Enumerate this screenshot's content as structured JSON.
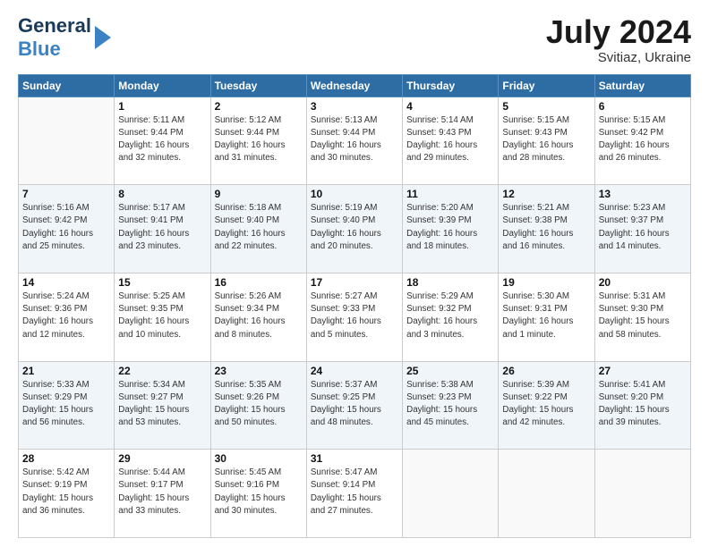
{
  "header": {
    "logo_line1": "General",
    "logo_line2": "Blue",
    "month_year": "July 2024",
    "location": "Svitiaz, Ukraine"
  },
  "days_of_week": [
    "Sunday",
    "Monday",
    "Tuesday",
    "Wednesday",
    "Thursday",
    "Friday",
    "Saturday"
  ],
  "weeks": [
    [
      {
        "day": "",
        "info": ""
      },
      {
        "day": "1",
        "info": "Sunrise: 5:11 AM\nSunset: 9:44 PM\nDaylight: 16 hours\nand 32 minutes."
      },
      {
        "day": "2",
        "info": "Sunrise: 5:12 AM\nSunset: 9:44 PM\nDaylight: 16 hours\nand 31 minutes."
      },
      {
        "day": "3",
        "info": "Sunrise: 5:13 AM\nSunset: 9:44 PM\nDaylight: 16 hours\nand 30 minutes."
      },
      {
        "day": "4",
        "info": "Sunrise: 5:14 AM\nSunset: 9:43 PM\nDaylight: 16 hours\nand 29 minutes."
      },
      {
        "day": "5",
        "info": "Sunrise: 5:15 AM\nSunset: 9:43 PM\nDaylight: 16 hours\nand 28 minutes."
      },
      {
        "day": "6",
        "info": "Sunrise: 5:15 AM\nSunset: 9:42 PM\nDaylight: 16 hours\nand 26 minutes."
      }
    ],
    [
      {
        "day": "7",
        "info": "Sunrise: 5:16 AM\nSunset: 9:42 PM\nDaylight: 16 hours\nand 25 minutes."
      },
      {
        "day": "8",
        "info": "Sunrise: 5:17 AM\nSunset: 9:41 PM\nDaylight: 16 hours\nand 23 minutes."
      },
      {
        "day": "9",
        "info": "Sunrise: 5:18 AM\nSunset: 9:40 PM\nDaylight: 16 hours\nand 22 minutes."
      },
      {
        "day": "10",
        "info": "Sunrise: 5:19 AM\nSunset: 9:40 PM\nDaylight: 16 hours\nand 20 minutes."
      },
      {
        "day": "11",
        "info": "Sunrise: 5:20 AM\nSunset: 9:39 PM\nDaylight: 16 hours\nand 18 minutes."
      },
      {
        "day": "12",
        "info": "Sunrise: 5:21 AM\nSunset: 9:38 PM\nDaylight: 16 hours\nand 16 minutes."
      },
      {
        "day": "13",
        "info": "Sunrise: 5:23 AM\nSunset: 9:37 PM\nDaylight: 16 hours\nand 14 minutes."
      }
    ],
    [
      {
        "day": "14",
        "info": "Sunrise: 5:24 AM\nSunset: 9:36 PM\nDaylight: 16 hours\nand 12 minutes."
      },
      {
        "day": "15",
        "info": "Sunrise: 5:25 AM\nSunset: 9:35 PM\nDaylight: 16 hours\nand 10 minutes."
      },
      {
        "day": "16",
        "info": "Sunrise: 5:26 AM\nSunset: 9:34 PM\nDaylight: 16 hours\nand 8 minutes."
      },
      {
        "day": "17",
        "info": "Sunrise: 5:27 AM\nSunset: 9:33 PM\nDaylight: 16 hours\nand 5 minutes."
      },
      {
        "day": "18",
        "info": "Sunrise: 5:29 AM\nSunset: 9:32 PM\nDaylight: 16 hours\nand 3 minutes."
      },
      {
        "day": "19",
        "info": "Sunrise: 5:30 AM\nSunset: 9:31 PM\nDaylight: 16 hours\nand 1 minute."
      },
      {
        "day": "20",
        "info": "Sunrise: 5:31 AM\nSunset: 9:30 PM\nDaylight: 15 hours\nand 58 minutes."
      }
    ],
    [
      {
        "day": "21",
        "info": "Sunrise: 5:33 AM\nSunset: 9:29 PM\nDaylight: 15 hours\nand 56 minutes."
      },
      {
        "day": "22",
        "info": "Sunrise: 5:34 AM\nSunset: 9:27 PM\nDaylight: 15 hours\nand 53 minutes."
      },
      {
        "day": "23",
        "info": "Sunrise: 5:35 AM\nSunset: 9:26 PM\nDaylight: 15 hours\nand 50 minutes."
      },
      {
        "day": "24",
        "info": "Sunrise: 5:37 AM\nSunset: 9:25 PM\nDaylight: 15 hours\nand 48 minutes."
      },
      {
        "day": "25",
        "info": "Sunrise: 5:38 AM\nSunset: 9:23 PM\nDaylight: 15 hours\nand 45 minutes."
      },
      {
        "day": "26",
        "info": "Sunrise: 5:39 AM\nSunset: 9:22 PM\nDaylight: 15 hours\nand 42 minutes."
      },
      {
        "day": "27",
        "info": "Sunrise: 5:41 AM\nSunset: 9:20 PM\nDaylight: 15 hours\nand 39 minutes."
      }
    ],
    [
      {
        "day": "28",
        "info": "Sunrise: 5:42 AM\nSunset: 9:19 PM\nDaylight: 15 hours\nand 36 minutes."
      },
      {
        "day": "29",
        "info": "Sunrise: 5:44 AM\nSunset: 9:17 PM\nDaylight: 15 hours\nand 33 minutes."
      },
      {
        "day": "30",
        "info": "Sunrise: 5:45 AM\nSunset: 9:16 PM\nDaylight: 15 hours\nand 30 minutes."
      },
      {
        "day": "31",
        "info": "Sunrise: 5:47 AM\nSunset: 9:14 PM\nDaylight: 15 hours\nand 27 minutes."
      },
      {
        "day": "",
        "info": ""
      },
      {
        "day": "",
        "info": ""
      },
      {
        "day": "",
        "info": ""
      }
    ]
  ]
}
